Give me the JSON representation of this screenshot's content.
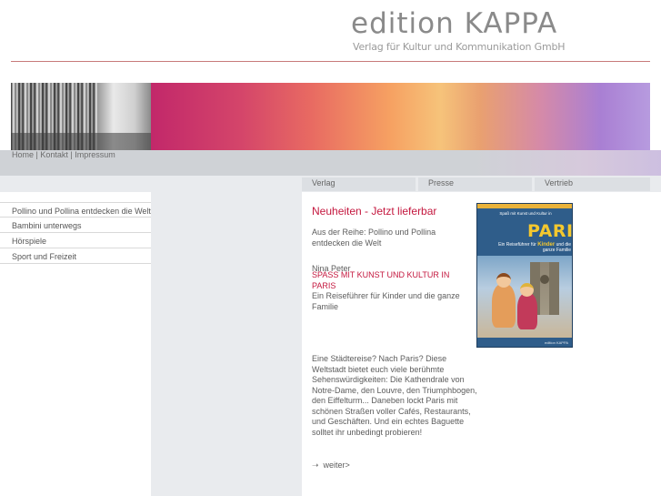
{
  "header": {
    "title": "edition KAPPA",
    "subtitle": "Verlag für Kultur und Kommunikation GmbH"
  },
  "top_nav": {
    "items": [
      "Home",
      "Kontakt",
      "Impressum"
    ],
    "separator": " | "
  },
  "tabs": [
    {
      "label": "Verlag"
    },
    {
      "label": "Presse"
    },
    {
      "label": "Vertrieb"
    }
  ],
  "sidebar": {
    "items": [
      {
        "label": "Pollino und Pollina entdecken die Welt"
      },
      {
        "label": "Bambini unterwegs"
      },
      {
        "label": "Hörspiele"
      },
      {
        "label": "Sport und Freizeit"
      }
    ]
  },
  "main": {
    "heading": "Neuheiten - Jetzt lieferbar",
    "series": "Aus der Reihe: Pollino und Pollina entdecken die Welt",
    "author": "Nina Peter",
    "book_title": "SPASS MIT KUNST UND KULTUR IN PARIS",
    "book_subtitle": "Ein Reiseführer für Kinder und die ganze Familie",
    "description": "Eine Städtereise? Nach Paris? Diese Weltstadt bietet euch viele berühmte Sehenswürdigkeiten: Die Kathendrale von Notre-Dame, den Louvre, den Triumphbogen, den Eiffelturm... Daneben lockt Paris mit schönen Straßen voller Cafés, Restaurants, und Geschäften. Und ein echtes Baguette solltet ihr unbedingt probieren!",
    "more_label": "weiter>",
    "more_icon": "arrow-right-icon"
  },
  "cover": {
    "top_text": "Spaß mit Kunst und Kultur in",
    "city": "PARIS",
    "line1": "Ein Reiseführer für",
    "line1_highlight": "Kinder",
    "line1_end": "und die",
    "line2": "ganze Familie",
    "publisher": "edition KAPPA"
  },
  "colors": {
    "accent": "#c4173e",
    "band": "#cfd2d6",
    "column_bg": "#e9ebee",
    "rule": "#c87a7a"
  }
}
